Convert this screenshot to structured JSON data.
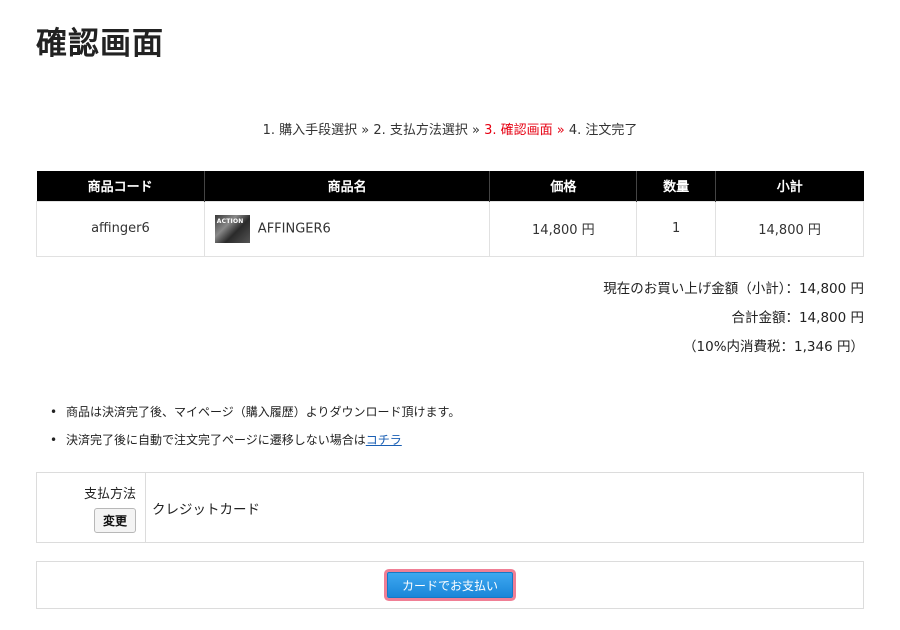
{
  "page": {
    "title": "確認画面"
  },
  "steps": [
    {
      "label": "1. 購入手段選択 »",
      "current": false
    },
    {
      "label": "2. 支払方法選択 »",
      "current": false
    },
    {
      "label": "3. 確認画面 »",
      "current": true
    },
    {
      "label": "4. 注文完了",
      "current": false
    }
  ],
  "table": {
    "headers": [
      "商品コード",
      "商品名",
      "価格",
      "数量",
      "小計"
    ],
    "row": {
      "code": "affinger6",
      "name": "AFFINGER6",
      "price": "14,800 円",
      "quantity": "1",
      "subtotal": "14,800 円"
    }
  },
  "totals": {
    "current_subtotal": "現在のお買い上げ金額（小計）：14,800 円",
    "total": "合計金額：14,800 円",
    "tax": "（10%内消費税：1,346 円）"
  },
  "notes": {
    "item1": "商品は決済完了後、マイページ（購入履歴）よりダウンロード頂けます。",
    "item2_prefix": "決済完了後に自動で注文完了ページに遷移しない場合は",
    "item2_link": "コチラ"
  },
  "payment": {
    "label": "支払方法",
    "change_label": "変更",
    "method": "クレジットカード"
  },
  "pay_button": {
    "label": "カードでお支払い"
  },
  "colors": {
    "accent_red": "#e60012",
    "header_bg": "#000000",
    "button_blue": "#1a86d9",
    "focus_ring": "#f07f95"
  }
}
